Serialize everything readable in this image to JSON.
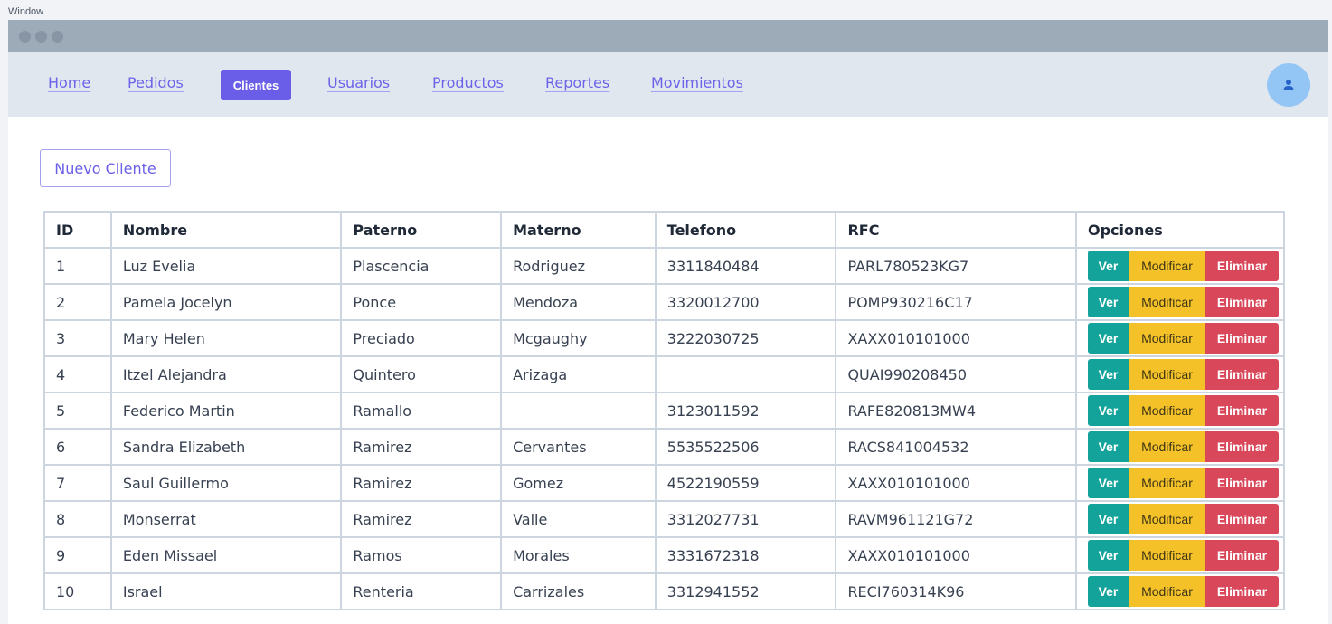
{
  "window": {
    "label": "Window"
  },
  "nav": {
    "links": [
      "Home",
      "Pedidos",
      "Clientes",
      "Usuarios",
      "Productos",
      "Reportes",
      "Movimientos"
    ],
    "active": "Clientes",
    "avatar_icon": "user-icon"
  },
  "actions": {
    "new_client": "Nuevo Cliente"
  },
  "table": {
    "headers": [
      "ID",
      "Nombre",
      "Paterno",
      "Materno",
      "Telefono",
      "RFC",
      "Opciones"
    ],
    "option_labels": {
      "view": "Ver",
      "edit": "Modificar",
      "delete": "Eliminar"
    },
    "rows": [
      [
        "1",
        "Luz Evelia",
        "Plascencia",
        "Rodriguez",
        "3311840484",
        "PARL780523KG7"
      ],
      [
        "2",
        "Pamela Jocelyn",
        "Ponce",
        "Mendoza",
        "3320012700",
        "POMP930216C17"
      ],
      [
        "3",
        "Mary Helen",
        "Preciado",
        "Mcgaughy",
        "3222030725",
        "XAXX010101000"
      ],
      [
        "4",
        "Itzel Alejandra",
        "Quintero",
        "Arizaga",
        "",
        "QUAI990208450"
      ],
      [
        "5",
        "Federico Martin",
        "Ramallo",
        "",
        "3123011592",
        "RAFE820813MW4"
      ],
      [
        "6",
        "Sandra Elizabeth",
        "Ramirez",
        "Cervantes",
        "5535522506",
        "RACS841004532"
      ],
      [
        "7",
        "Saul Guillermo",
        "Ramirez",
        "Gomez",
        "4522190559",
        "XAXX010101000"
      ],
      [
        "8",
        "Monserrat",
        "Ramirez",
        "Valle",
        "3312027731",
        "RAVM961121G72"
      ],
      [
        "9",
        "Eden Missael",
        "Ramos",
        "Morales",
        "3331672318",
        "XAXX010101000"
      ],
      [
        "10",
        "Israel",
        "Renteria",
        "Carrizales",
        "3312941552",
        "RECI760314K96"
      ]
    ]
  }
}
